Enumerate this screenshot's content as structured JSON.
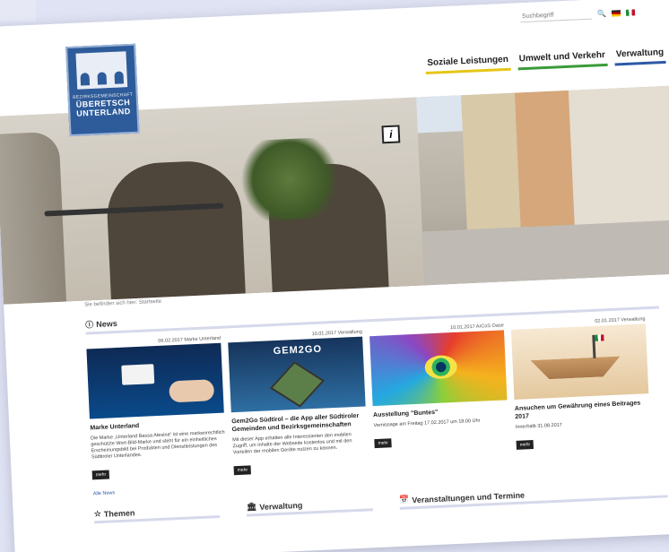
{
  "header": {
    "logo": {
      "line1": "BEZIRKSGEMEINSCHAFT",
      "line2": "ÜBERETSCH",
      "line3": "UNTERLAND"
    },
    "search_placeholder": "Suchbegriff",
    "icons": [
      "search-icon",
      "flag-de-icon",
      "flag-it-icon"
    ],
    "nav": [
      {
        "label": "Soziale Leistungen",
        "color": "#e6c617"
      },
      {
        "label": "Umwelt und Verkehr",
        "color": "#3b9b38"
      },
      {
        "label": "Verwaltung",
        "color": "#2d5aa8"
      }
    ]
  },
  "breadcrumb": "Sie befinden sich hier: Startseite",
  "news": {
    "title": "News",
    "items": [
      {
        "date": "06.02.2017",
        "category": "Marke Unterland",
        "title": "Marke Unterland",
        "desc": "Die Marke „Unterland Bassa Atesina“ ist eine markenrechtlich geschützte Wort-Bild-Marke und steht für ein einheitliches Erscheinungsbild bei Produkten und Dienstleistungen des Südtiroler Unterlandes.",
        "more": "mehr"
      },
      {
        "date": "10.01.2017",
        "category": "Verwaltung",
        "title": "Gem2Go Südtirol – die App aller Südtiroler Gemeinden und Bezirksgemeinschaften",
        "desc": "Mit dieser App erhalten alle Interessierten den mobilen Zugriff, um Inhalte der Webseite kostenlos und mit den Vorteilen der mobilen Geräte nutzen zu können.",
        "more": "mehr",
        "thumb_text": "GEM2GO"
      },
      {
        "date": "10.01.2017",
        "category": "ArCoS Oase",
        "title": "Ausstellung \"Buntes\"",
        "desc": "Vernissage am Freitag 17.02.2017 um 18.00 Uhr",
        "more": "mehr"
      },
      {
        "date": "02.01.2017",
        "category": "Verwaltung",
        "title": "Ansuchen um Gewährung eines Beitrages 2017",
        "desc": "Innerhalb 31.08.2017",
        "more": "mehr"
      }
    ],
    "all_link": "Alle News"
  },
  "sections": {
    "themen": "Themen",
    "verwaltung": "Verwaltung",
    "veranstaltungen": "Veranstaltungen und Termine"
  }
}
